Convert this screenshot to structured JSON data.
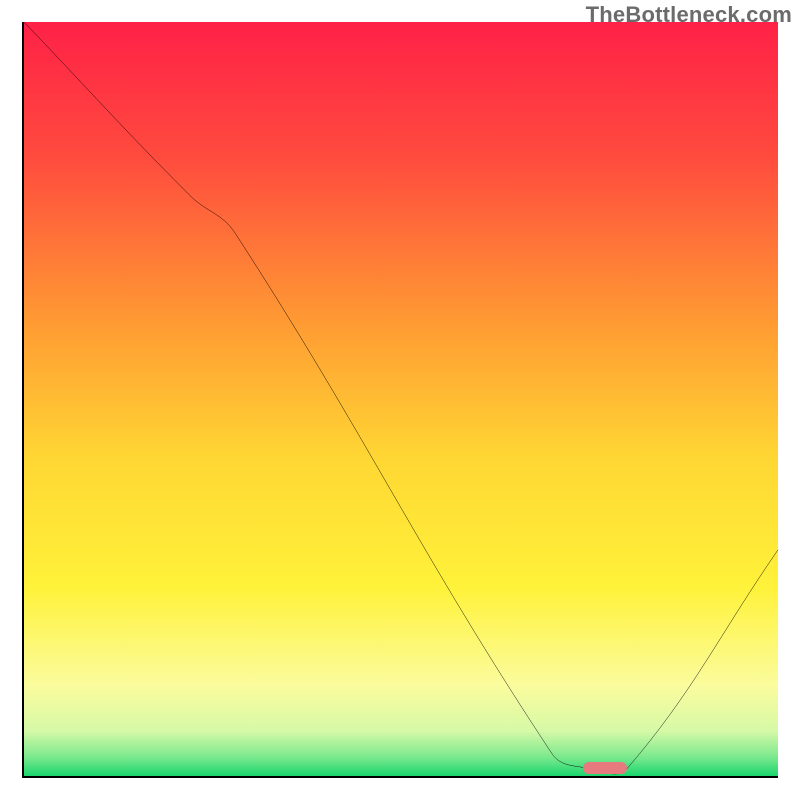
{
  "watermark": "TheBottleneck.com",
  "chart_data": {
    "type": "line",
    "title": "",
    "xlabel": "",
    "ylabel": "",
    "xlim": [
      0,
      100
    ],
    "ylim": [
      0,
      100
    ],
    "grid": false,
    "legend": false,
    "background_gradient": {
      "stops": [
        {
          "pos": 0.0,
          "color": "#ff2147"
        },
        {
          "pos": 0.18,
          "color": "#ff4b3e"
        },
        {
          "pos": 0.4,
          "color": "#ff9b33"
        },
        {
          "pos": 0.58,
          "color": "#ffd733"
        },
        {
          "pos": 0.75,
          "color": "#fff23a"
        },
        {
          "pos": 0.88,
          "color": "#fbfc9d"
        },
        {
          "pos": 0.94,
          "color": "#d6f9a7"
        },
        {
          "pos": 0.975,
          "color": "#7be98e"
        },
        {
          "pos": 1.0,
          "color": "#1bd66f"
        }
      ]
    },
    "series": [
      {
        "name": "bottleneck-curve",
        "x": [
          0,
          22,
          28,
          70,
          75,
          80,
          100
        ],
        "y": [
          100,
          77,
          72,
          3,
          1,
          1,
          30
        ]
      }
    ],
    "marker": {
      "x": 77,
      "y": 1,
      "color": "#e77a7f"
    }
  }
}
